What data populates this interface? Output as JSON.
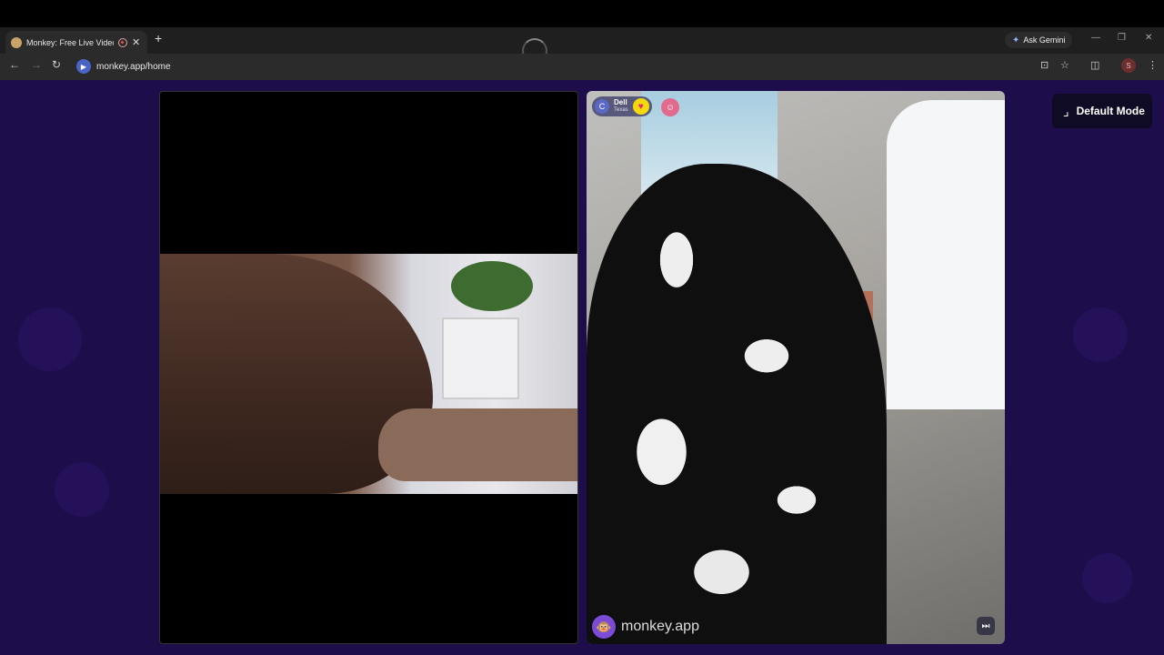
{
  "browser": {
    "tab_title": "Monkey: Free Live Video Chat",
    "url": "monkey.app/home",
    "gemini_label": "Ask Gemini",
    "profile_initial": "S"
  },
  "page": {
    "mode_button_label": "Default Mode",
    "partner": {
      "avatar_initial": "C",
      "name": "Dell",
      "country": "Texas"
    },
    "watermark": "monkey.app"
  },
  "colors": {
    "page_background": "#1d0d4a",
    "accent_purple": "#7b4bd8",
    "heart_badge": "#f5d90a"
  },
  "icons": {
    "tab_favicon": "monkey-favicon-icon",
    "recording": "recording-icon",
    "close": "close-icon",
    "new_tab": "plus-icon",
    "gemini": "sparkle-icon",
    "back": "arrow-left-icon",
    "forward": "arrow-right-icon",
    "reload": "reload-icon",
    "site_info": "video-camera-icon",
    "install": "install-app-icon",
    "bookmark": "star-icon",
    "side_panel": "side-panel-icon",
    "menu": "kebab-menu-icon",
    "mode": "collapse-icon",
    "heart": "heart-icon",
    "skip": "skip-icon"
  }
}
